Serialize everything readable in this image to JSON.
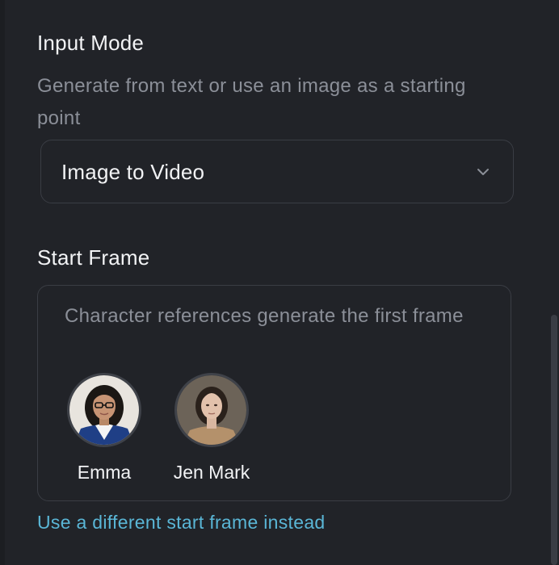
{
  "input_mode": {
    "title": "Input Mode",
    "description": "Generate from text or use an image as a starting point",
    "selected": "Image to Video",
    "chevron_icon": "chevron-down-icon"
  },
  "start_frame": {
    "title": "Start Frame",
    "description": "Character references generate the first frame",
    "characters": [
      {
        "name": "Emma"
      },
      {
        "name": "Jen Mark"
      }
    ],
    "alt_link": "Use a different start frame instead"
  },
  "colors": {
    "background": "#212328",
    "text_primary": "#f2f3f5",
    "text_secondary": "#8b8f98",
    "border": "#3a3d44",
    "link": "#5ab6d6"
  }
}
